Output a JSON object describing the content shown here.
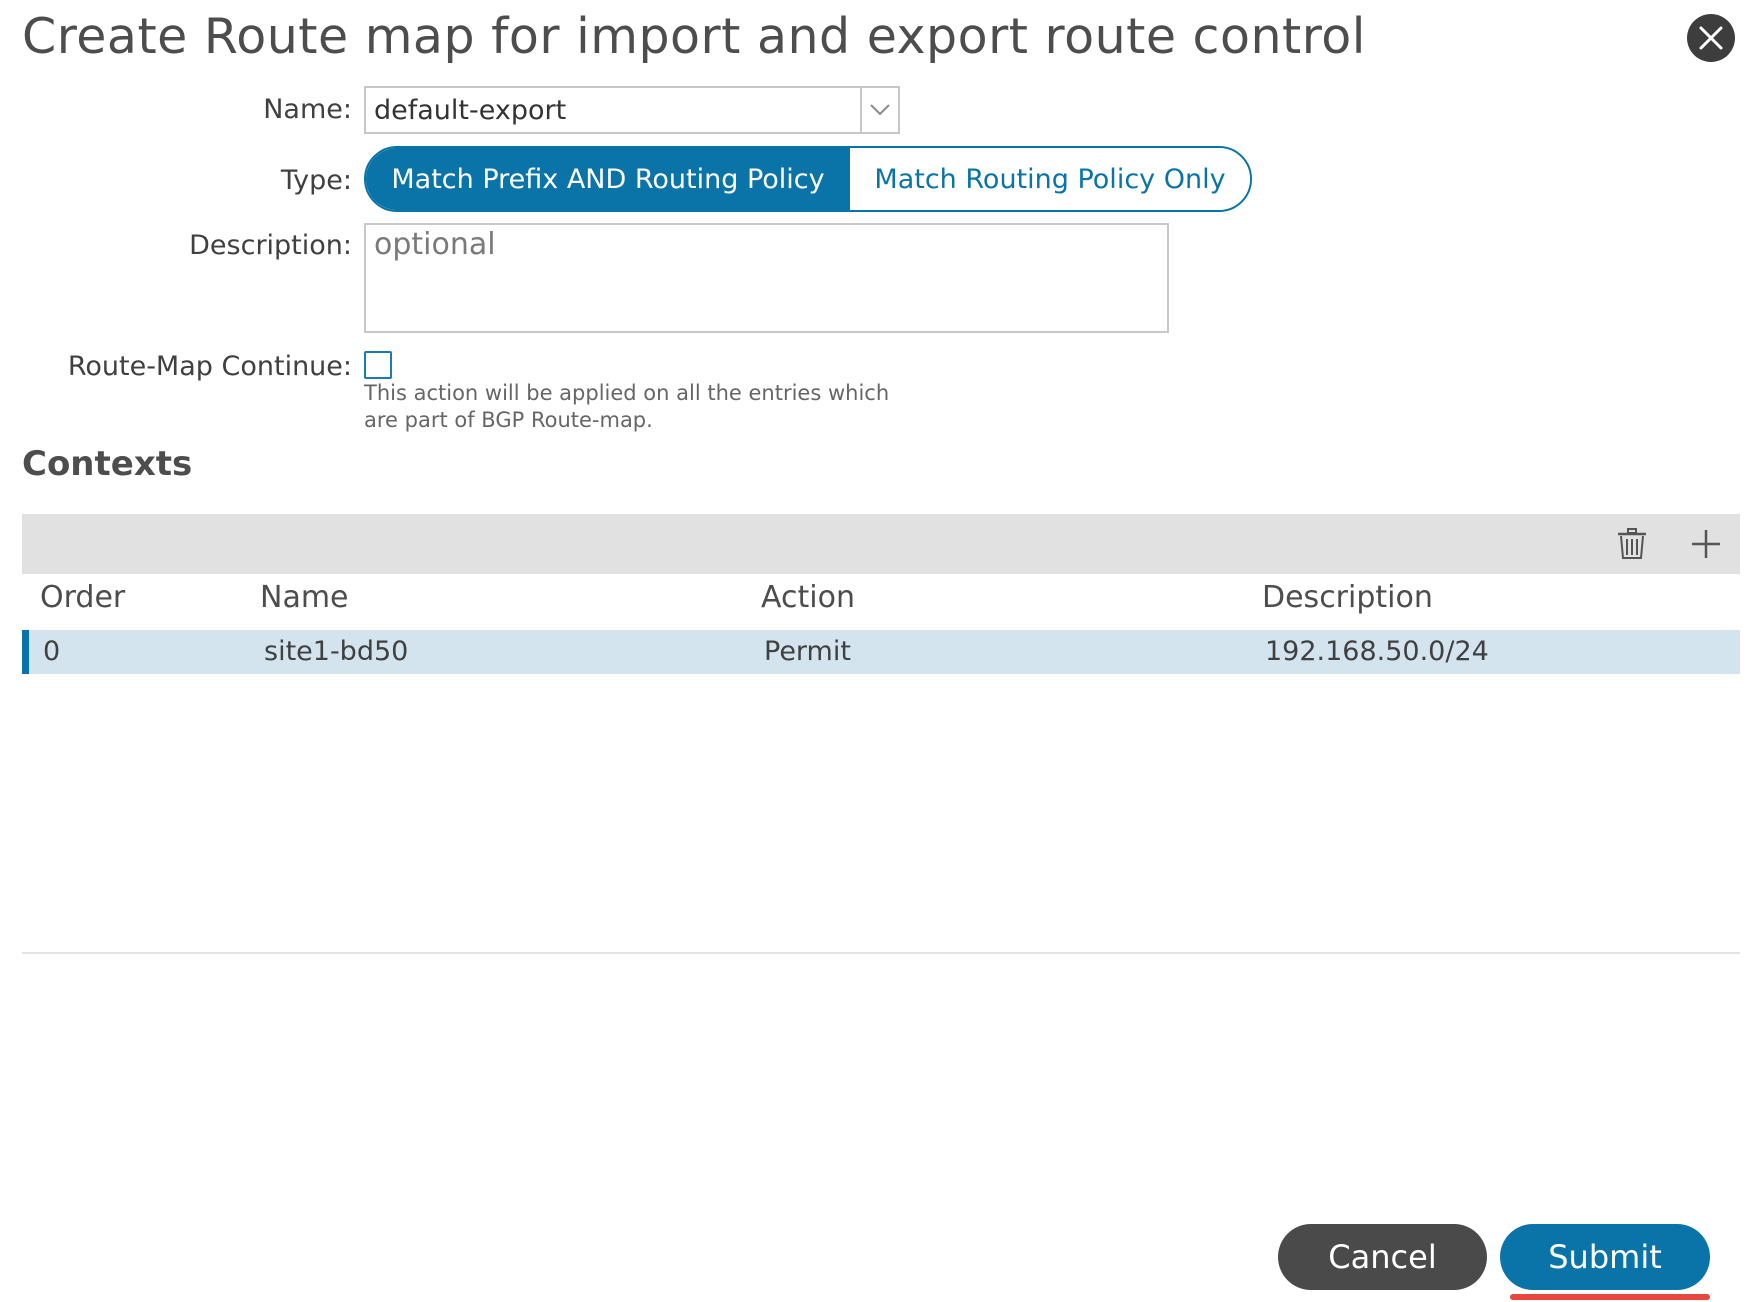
{
  "dialog": {
    "title": "Create Route map for import and export route control"
  },
  "form": {
    "name_label": "Name:",
    "name_value": "default-export",
    "type_label": "Type:",
    "type_options": [
      "Match Prefix AND Routing Policy",
      "Match Routing Policy Only"
    ],
    "type_selected": "Match Prefix AND Routing Policy",
    "description_label": "Description:",
    "description_placeholder": "optional",
    "continue_label": "Route-Map Continue:",
    "continue_checked": false,
    "continue_help_line1": "This action will be applied on all the entries which",
    "continue_help_line2": "are part of BGP Route-map."
  },
  "contexts": {
    "heading": "Contexts",
    "columns": [
      "Order",
      "Name",
      "Action",
      "Description"
    ],
    "rows": [
      {
        "order": "0",
        "name": "site1-bd50",
        "action": "Permit",
        "description": "192.168.50.0/24"
      }
    ]
  },
  "footer": {
    "cancel_label": "Cancel",
    "submit_label": "Submit"
  },
  "colors": {
    "accent": "#0a74a8",
    "row_selected": "#d4e4ef",
    "toolbar_bg": "#e1e1e1",
    "cancel_bg": "#4a4a4a",
    "underline": "#e8473e"
  },
  "icons": {
    "close": "close-icon",
    "dropdown": "chevron-down-icon",
    "delete": "trash-icon",
    "add": "plus-icon"
  }
}
